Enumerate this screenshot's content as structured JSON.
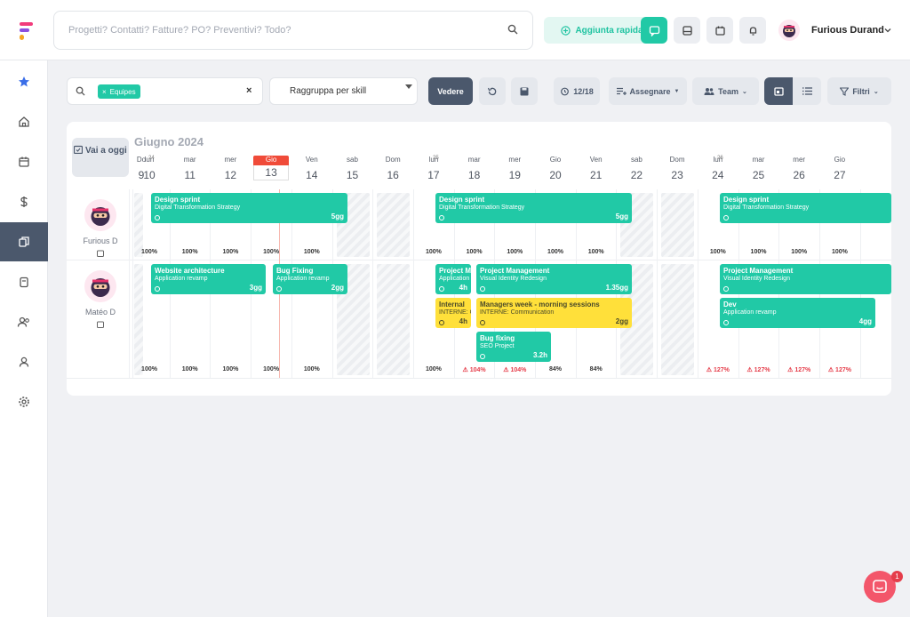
{
  "search": {
    "placeholder": "Progetti? Contatti? Fatture? PO? Preventivi? Todo?"
  },
  "quick_add": "Aggiunta rapida",
  "user": {
    "name": "Furious Durand"
  },
  "toolbar": {
    "chip": "Equipes",
    "group_by": "Raggruppa per skill",
    "view": "Vedere",
    "count": "12/18",
    "assign": "Assegnare",
    "team": "Team",
    "filters": "Filtri"
  },
  "calendar": {
    "goto_today": "Vai a oggi",
    "month": "Giugno 2024",
    "days": [
      {
        "n": "lun",
        "d": "10"
      },
      {
        "n": "mar",
        "d": "11"
      },
      {
        "n": "mer",
        "d": "12"
      },
      {
        "n": "Gio",
        "d": "13"
      },
      {
        "n": "Ven",
        "d": "14"
      },
      {
        "n": "sab",
        "d": "15"
      },
      {
        "n": "Dom",
        "d": "16"
      },
      {
        "n": "lun",
        "d": "17"
      },
      {
        "n": "mar",
        "d": "18"
      },
      {
        "n": "mer",
        "d": "19"
      },
      {
        "n": "Gio",
        "d": "20"
      },
      {
        "n": "Ven",
        "d": "21"
      },
      {
        "n": "sab",
        "d": "22"
      },
      {
        "n": "Dom",
        "d": "23"
      },
      {
        "n": "lun",
        "d": "24"
      },
      {
        "n": "mar",
        "d": "25"
      },
      {
        "n": "mer",
        "d": "26"
      },
      {
        "n": "Gio",
        "d": "27"
      }
    ],
    "weeks": [
      "24",
      "25",
      "26"
    ],
    "members": [
      "Furious D",
      "Matéo D"
    ],
    "tasks": [
      {
        "t": "Design sprint",
        "s": "Digital Transformation Strategy",
        "d": "5gg"
      },
      {
        "t": "Design sprint",
        "s": "Digital Transformation Strategy",
        "d": "5gg"
      },
      {
        "t": "Design sprint",
        "s": "Digital Transformation Strategy",
        "d": ""
      },
      {
        "t": "Website architecture",
        "s": "Application revamp",
        "d": "3gg"
      },
      {
        "t": "Bug Fixing",
        "s": "Application revamp",
        "d": "2gg"
      },
      {
        "t": "Project Management",
        "s": "Application revamp",
        "d": "4h"
      },
      {
        "t": "Project Management",
        "s": "Visual Identity Redesign",
        "d": "1.35gg"
      },
      {
        "t": "Internal",
        "s": "INTERNE: Communication",
        "d": "4h"
      },
      {
        "t": "Managers week - morning sessions",
        "s": "INTERNE: Communication",
        "d": "2gg"
      },
      {
        "t": "Bug fixing",
        "s": "SEO Project",
        "d": "3.2h"
      },
      {
        "t": "Project Management",
        "s": "Visual Identity Redesign",
        "d": ""
      },
      {
        "t": "Dev",
        "s": "Application revamp",
        "d": "4gg"
      }
    ],
    "row1_pct": [
      "100%",
      "100%",
      "100%",
      "100%",
      "100%",
      "100%",
      "100%",
      "100%",
      "100%",
      "100%",
      "100%",
      "100%",
      "100%",
      "100%",
      "100%"
    ],
    "row2_pct": [
      "100%",
      "100%",
      "100%",
      "100%",
      "100%",
      "100%",
      "104%",
      "104%",
      "84%",
      "84%",
      "127%",
      "127%",
      "127%",
      "127%"
    ]
  },
  "chat_badge": "1"
}
